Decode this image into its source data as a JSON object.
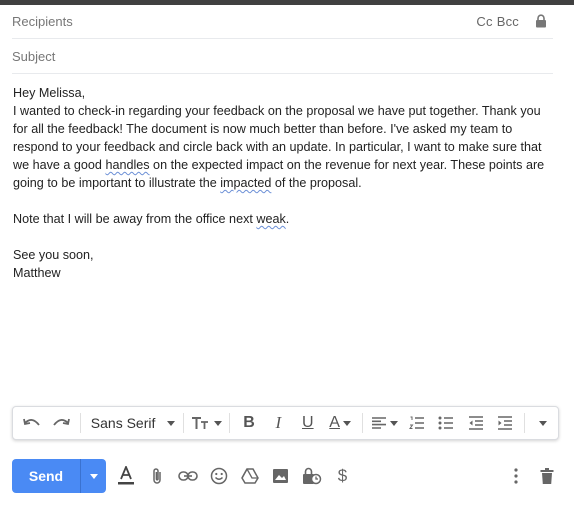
{
  "compose": {
    "recipients_placeholder": "Recipients",
    "cc_label": "Cc",
    "bcc_label": "Bcc",
    "subject_placeholder": "Subject"
  },
  "body": {
    "greeting": "Hey Melissa,",
    "para1_part1": "I wanted to check-in regarding your feedback on the proposal we have put together. Thank you for all the feedback! The document is now much better than before. I've asked my team to respond to your feedback and circle back with an update. In particular, I want to make sure that we have a good ",
    "para1_misspelled1": "handles",
    "para1_part2": " on the expected impact on the revenue for next year. These points are going to be important to illustrate the ",
    "para1_misspelled2": "impacted",
    "para1_part3": " of the proposal.",
    "para2_part1": "Note that I will be away from the office next ",
    "para2_misspelled": "weak",
    "para2_part2": ".",
    "closing": "See you soon,",
    "signature": "Matthew"
  },
  "formatting": {
    "font_family": "Sans Serif",
    "bold": "B",
    "italic": "I",
    "underline": "U",
    "text_color": "A"
  },
  "actions": {
    "send_label": "Send",
    "payment": "$"
  },
  "colors": {
    "send_button": "#4a8af4",
    "spellcheck_underline": "#6b8fd6"
  }
}
